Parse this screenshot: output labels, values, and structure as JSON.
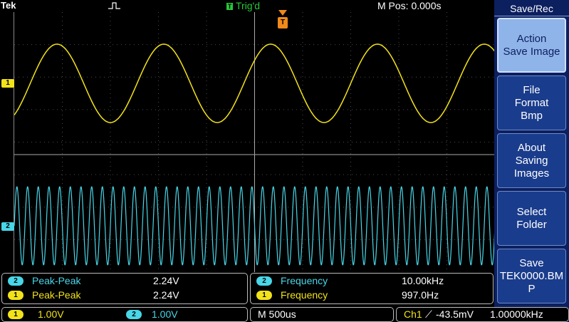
{
  "header": {
    "brand": "Tek",
    "trigger_status": "Trig'd",
    "trigger_box_label": "T",
    "mpos": "M Pos: 0.000s"
  },
  "screen": {
    "trigger_marker_label": "T",
    "ch1_marker": "1",
    "ch2_marker": "2",
    "ch1_color": "#f2e21a",
    "ch2_color": "#48d6e8",
    "grid_color": "#4a4a4a"
  },
  "side_menu": {
    "title": "Save/Rec",
    "buttons": [
      {
        "line1": "Action",
        "line2": "Save Image",
        "line3": ""
      },
      {
        "line1": "File",
        "line2": "Format",
        "line3": "Bmp"
      },
      {
        "line1": "About",
        "line2": "Saving",
        "line3": "Images"
      },
      {
        "line1": "Select",
        "line2": "Folder",
        "line3": ""
      },
      {
        "line1": "Save",
        "line2": "TEK0000.BM",
        "line3": "P"
      }
    ]
  },
  "measurements_left": [
    {
      "channel": "2",
      "name": "Peak-Peak",
      "value": "2.24V"
    },
    {
      "channel": "1",
      "name": "Peak-Peak",
      "value": "2.24V"
    }
  ],
  "measurements_right": [
    {
      "channel": "2",
      "name": "Frequency",
      "value": "10.00kHz"
    },
    {
      "channel": "1",
      "name": "Frequency",
      "value": "997.0Hz"
    }
  ],
  "status_bar": {
    "ch1_badge": "1",
    "ch1_scale": "1.00V",
    "ch2_badge": "2",
    "ch2_scale": "1.00V",
    "timebase": "M 500us",
    "trigger_source": "Ch1",
    "trigger_slope": "⟋",
    "trigger_level": "-43.5mV",
    "trigger_freq": "1.00000kHz"
  }
}
